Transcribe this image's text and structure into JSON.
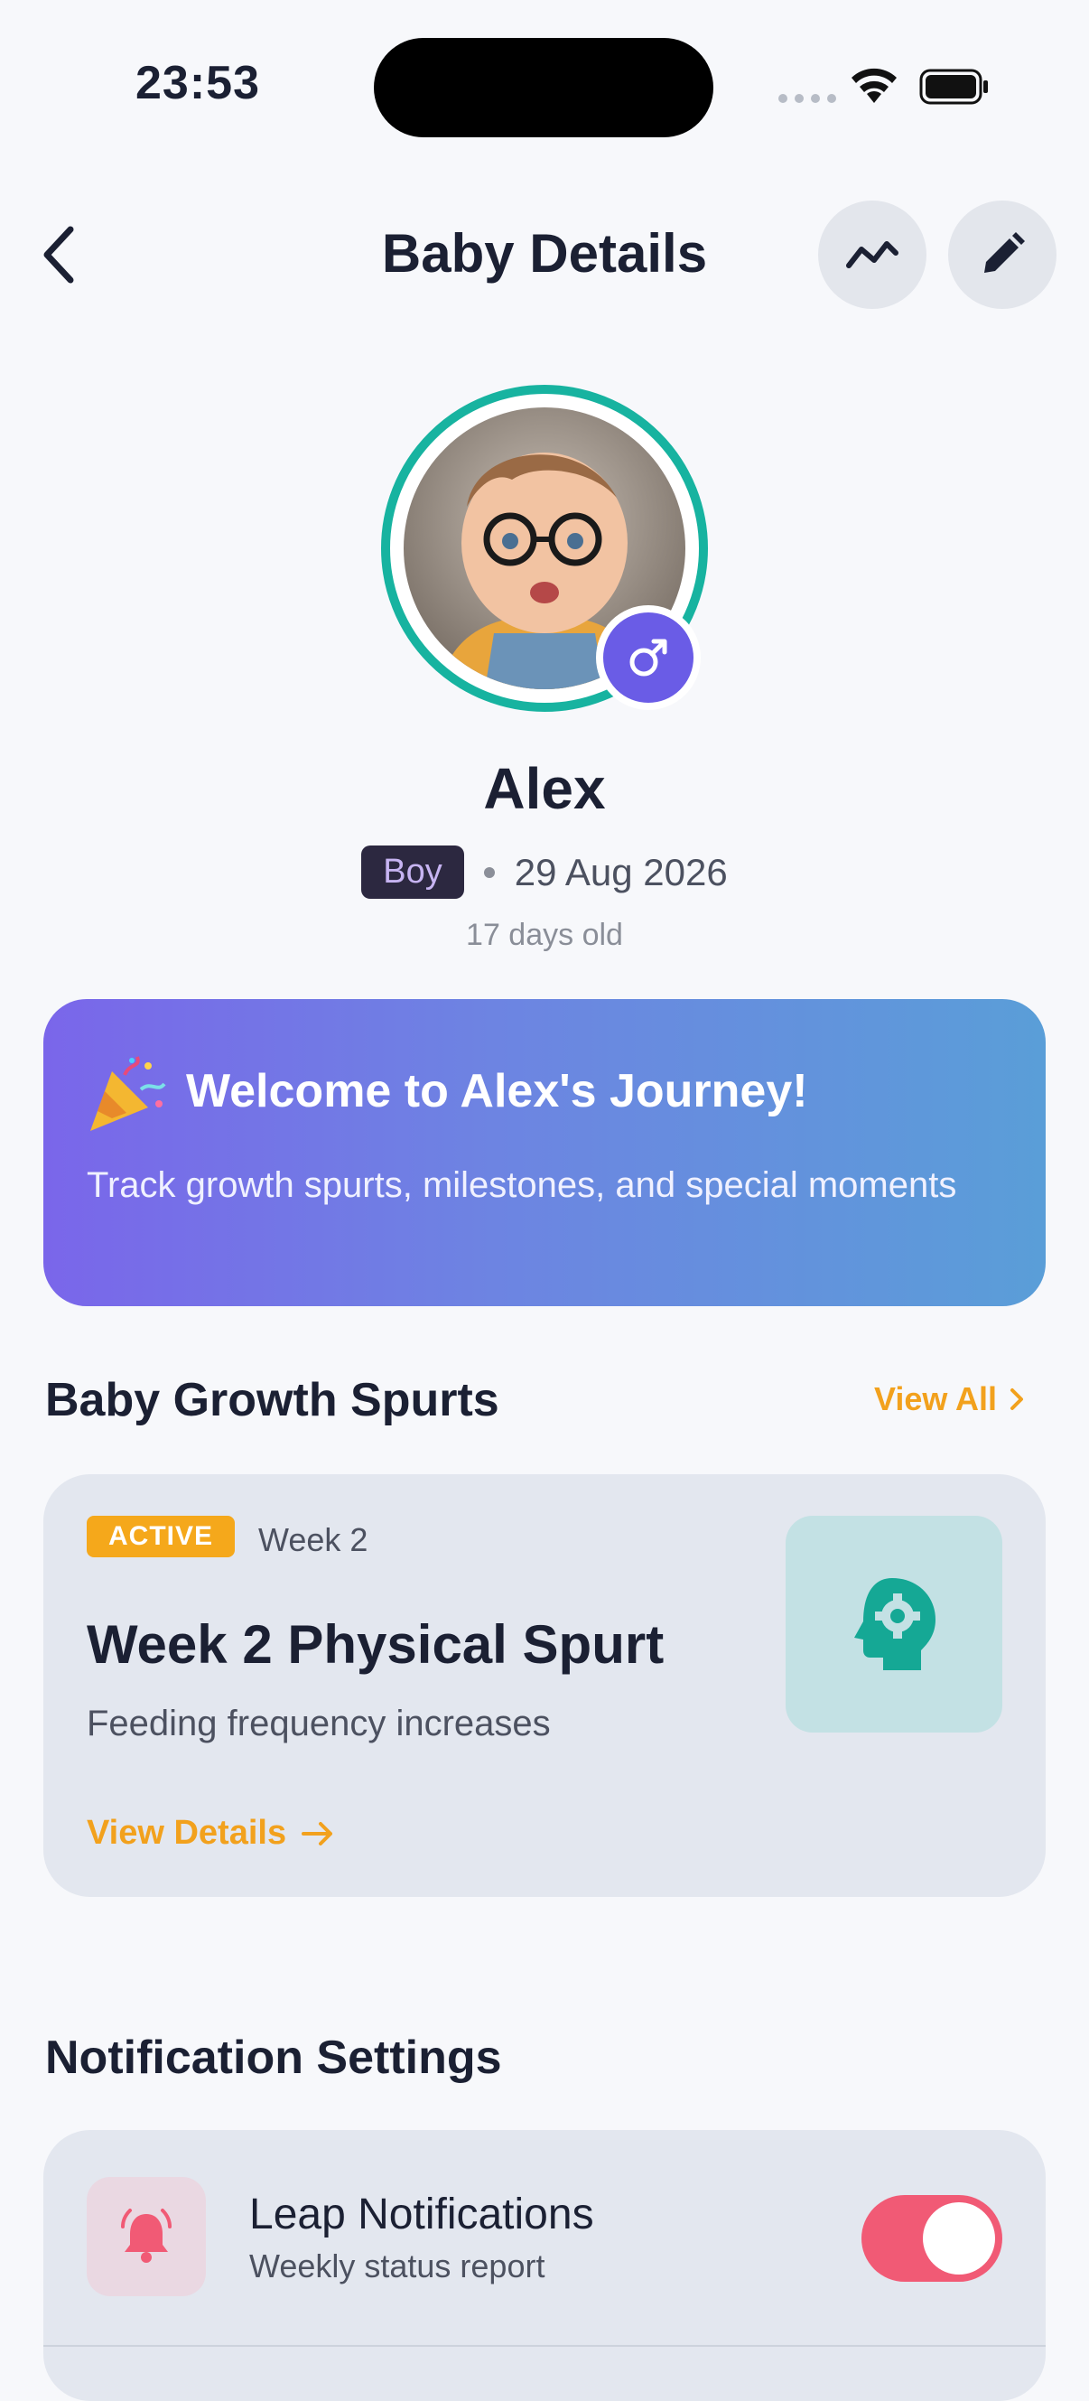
{
  "status_bar": {
    "time": "23:53"
  },
  "header": {
    "title": "Baby Details"
  },
  "profile": {
    "name": "Alex",
    "gender_tag": "Boy",
    "birth_date": "29 Aug 2026",
    "age": "17 days old"
  },
  "banner": {
    "title": "Welcome to Alex's Journey!",
    "text": "Track growth spurts, milestones, and special moments"
  },
  "growth": {
    "section_title": "Baby Growth Spurts",
    "view_all": "View All",
    "card": {
      "status": "ACTIVE",
      "week": "Week 2",
      "title": "Week 2 Physical Spurt",
      "description": "Feeding frequency increases",
      "view_details": "View Details"
    }
  },
  "notifications": {
    "section_title": "Notification Settings",
    "item": {
      "title": "Leap Notifications",
      "subtitle": "Weekly status report",
      "enabled": true
    }
  },
  "colors": {
    "accent_teal": "#17b3a0",
    "accent_orange": "#f2a11d",
    "accent_purple": "#6a5ce6",
    "toggle_on": "#f15a75"
  }
}
